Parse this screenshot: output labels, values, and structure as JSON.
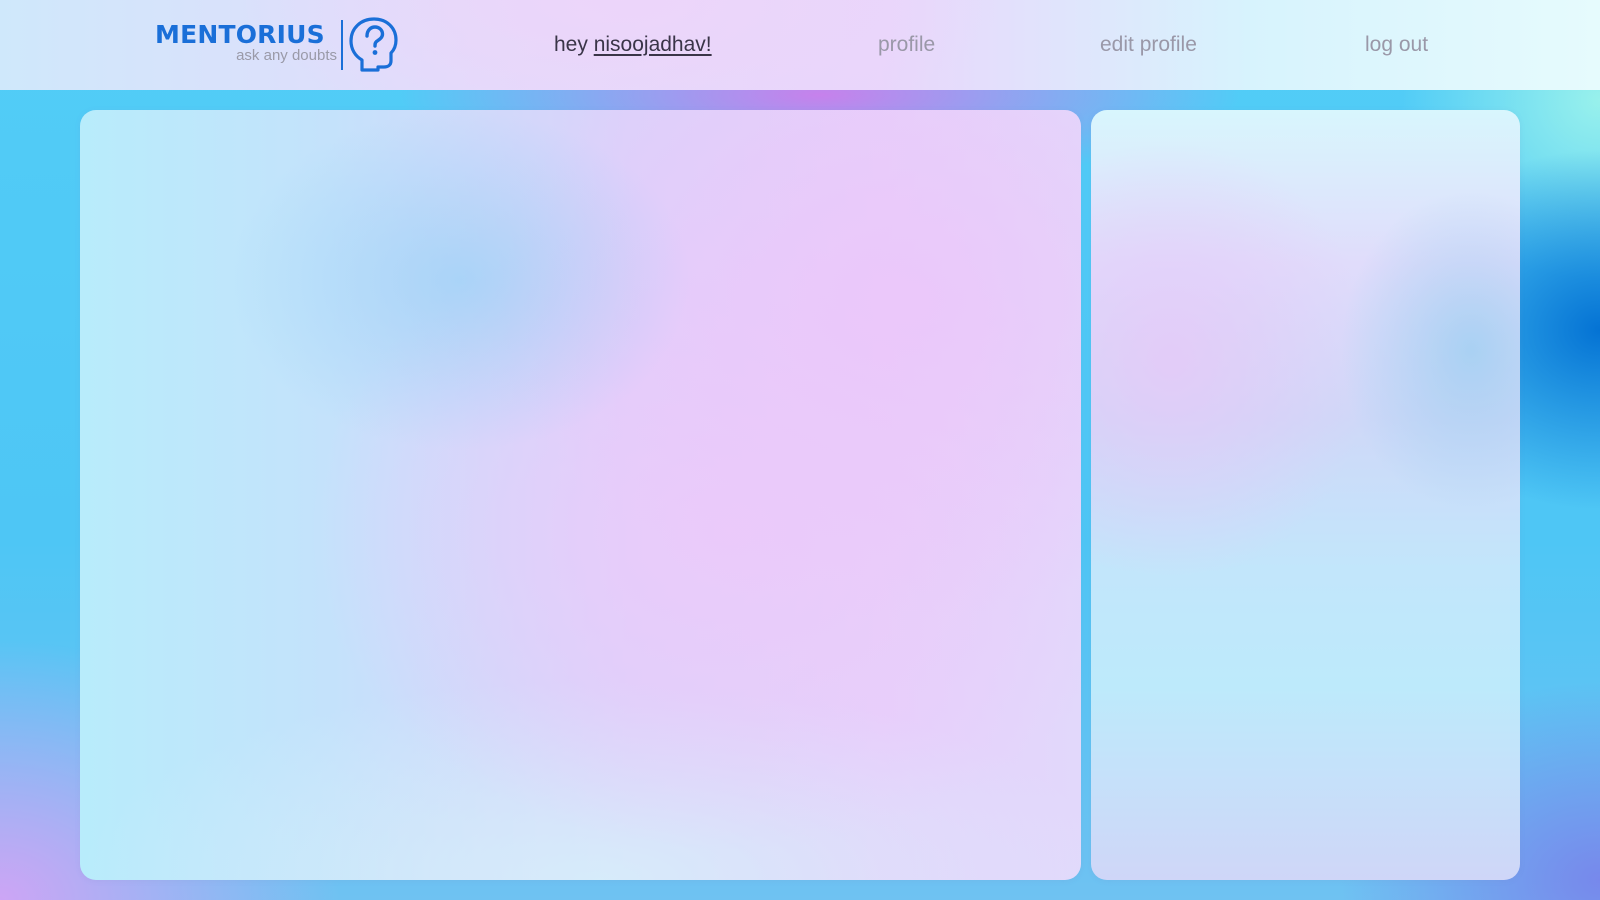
{
  "header": {
    "logo": {
      "name": "MENTORIUS",
      "tagline": "ask any doubts",
      "icon": "question-head-icon"
    },
    "greeting_prefix": "hey",
    "username": "nisoojadhav!",
    "nav": {
      "profile_label": "profile",
      "edit_profile_label": "edit profile",
      "logout_label": "log out"
    }
  },
  "colors": {
    "brand": "#1a6fd8",
    "nav_active": "#3a3548",
    "nav_inactive": "#9a98a8",
    "tagline": "#9a9aa8"
  }
}
